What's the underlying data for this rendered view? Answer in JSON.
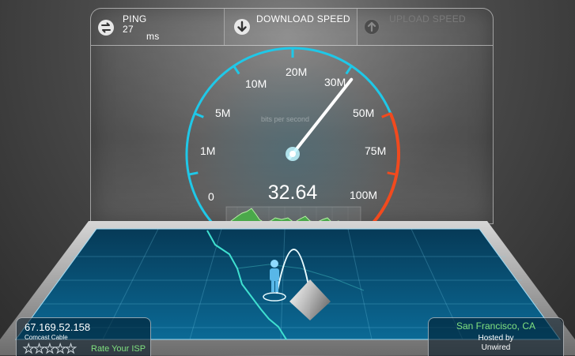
{
  "tabs": {
    "ping": {
      "label": "PING",
      "value": "27",
      "unit": "ms",
      "icon": "ping-arrows-icon"
    },
    "download": {
      "label": "DOWNLOAD SPEED",
      "icon": "download-arrow-icon"
    },
    "upload": {
      "label": "UPLOAD SPEED",
      "icon": "upload-arrow-icon"
    }
  },
  "gauge": {
    "unit_caption": "bits per second",
    "current_value": "32.64",
    "scale": [
      "0",
      "1M",
      "5M",
      "10M",
      "20M",
      "30M",
      "50M",
      "75M",
      "100M"
    ],
    "needle_reading_mbps": 32.64
  },
  "client": {
    "ip": "67.169.52.158",
    "isp": "Comcast Cable",
    "rating_stars": 0,
    "rate_label": "Rate Your ISP"
  },
  "server": {
    "location": "San Francisco, CA",
    "hosted_by": "Hosted by",
    "host": "Unwired"
  },
  "colors": {
    "accent_cyan": "#1fc8e8",
    "accent_red": "#f24a1e",
    "accent_green": "#7fe07f"
  }
}
